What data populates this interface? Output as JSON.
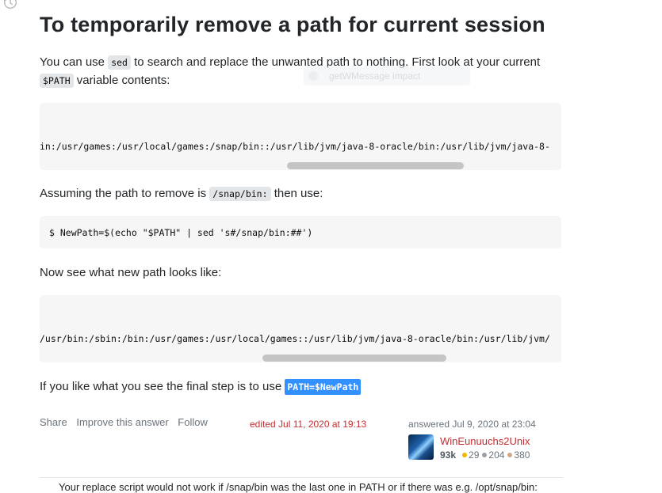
{
  "title": "To temporarily remove a path for current session",
  "intro": {
    "before": "You can use ",
    "code1": "sed",
    "middle": " to search and replace the unwanted path to nothing. First look at your current",
    "code2": "$PATH",
    "after": " variable contents:"
  },
  "tooltip_ghost": "getWMessage impact",
  "code_block_1": "in:/usr/games:/usr/local/games:/snap/bin::/usr/lib/jvm/java-8-oracle/bin:/usr/lib/jvm/java-8-",
  "assume": {
    "before": "Assuming the path to remove is ",
    "code": "/snap/bin:",
    "after": " then use:"
  },
  "code_block_2": "$ NewPath=$(echo \"$PATH\" | sed 's#/snap/bin:##')",
  "now_see": "Now see what new path looks like:",
  "code_block_3": "/usr/bin:/sbin:/bin:/usr/games:/usr/local/games::/usr/lib/jvm/java-8-oracle/bin:/usr/lib/jvm/",
  "final": {
    "before": "If you like what you see the final step is to use ",
    "code": "PATH=$NewPath"
  },
  "post_menu": {
    "share": "Share",
    "improve": "Improve this answer",
    "follow": "Follow"
  },
  "edited": "edited Jul 11, 2020 at 19:13",
  "answered": "answered Jul 9, 2020 at 23:04",
  "user": {
    "name": "WinEunuuchs2Unix",
    "reputation": "93k",
    "gold": "29",
    "silver": "204",
    "bronze": "380"
  },
  "badge_colors": {
    "gold": "#f1b600",
    "silver": "#9a9fa5",
    "bronze": "#d1a684"
  },
  "comment_preview": "Your replace script would not work if /snap/bin was the last one in PATH or if there was e.g. /opt/snap/bin:"
}
